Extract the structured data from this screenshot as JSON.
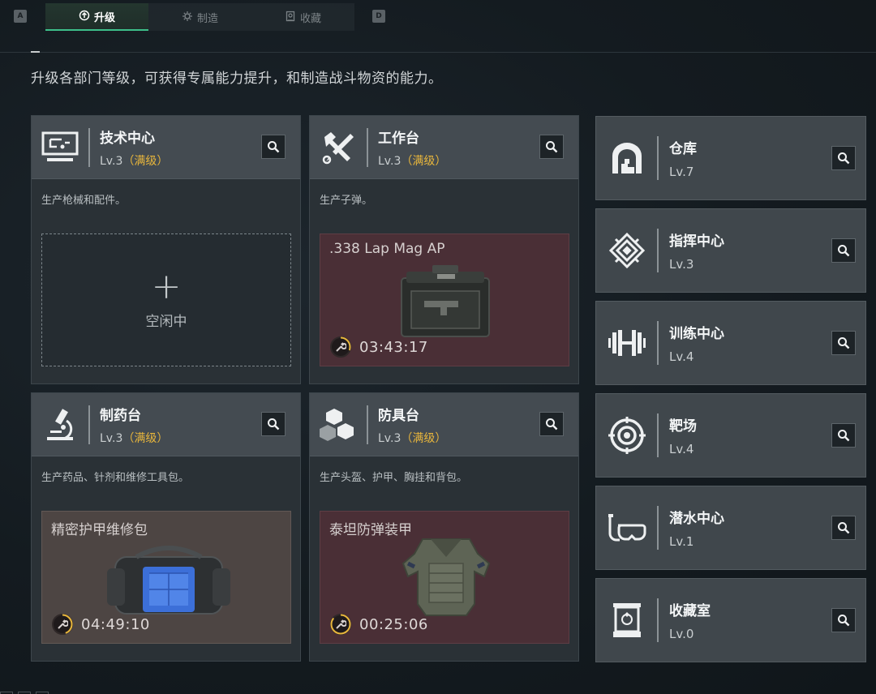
{
  "topbar": {
    "left_key": "A",
    "right_key": "D",
    "tabs": [
      {
        "label": "升级",
        "icon": "upgrade-icon",
        "active": true
      },
      {
        "label": "制造",
        "icon": "craft-icon",
        "active": false
      },
      {
        "label": "收藏",
        "icon": "collection-icon",
        "active": false
      }
    ]
  },
  "description": "升级各部门等级，可获得专属能力提升，和制造战斗物资的能力。",
  "cards": [
    {
      "title": "技术中心",
      "level": "Lv.3",
      "max": "（满级）",
      "desc": "生产枪械和配件。",
      "slot": {
        "state": "idle",
        "label": "空闲中"
      }
    },
    {
      "title": "工作台",
      "level": "Lv.3",
      "max": "（满级）",
      "desc": "生产子弹。",
      "slot": {
        "state": "crafting",
        "item": ".338 Lap Mag AP",
        "time": "03:43:17",
        "progress": 0.3
      }
    },
    {
      "title": "制药台",
      "level": "Lv.3",
      "max": "（满级）",
      "desc": "生产药品、针剂和维修工具包。",
      "slot": {
        "state": "crafting",
        "item": "精密护甲维修包",
        "time": "04:49:10",
        "progress": 0.45
      }
    },
    {
      "title": "防具台",
      "level": "Lv.3",
      "max": "（满级）",
      "desc": "生产头盔、护甲、胸挂和背包。",
      "slot": {
        "state": "crafting",
        "item": "泰坦防弹装甲",
        "time": "00:25:06",
        "progress": 0.85
      }
    }
  ],
  "facilities": [
    {
      "title": "仓库",
      "level": "Lv.7",
      "icon": "warehouse-icon"
    },
    {
      "title": "指挥中心",
      "level": "Lv.3",
      "icon": "command-center-icon"
    },
    {
      "title": "训练中心",
      "level": "Lv.4",
      "icon": "dumbbell-icon"
    },
    {
      "title": "靶场",
      "level": "Lv.4",
      "icon": "target-icon"
    },
    {
      "title": "潜水中心",
      "level": "Lv.1",
      "icon": "diving-mask-icon"
    },
    {
      "title": "收藏室",
      "level": "Lv.0",
      "icon": "trophy-case-icon"
    }
  ],
  "colors": {
    "accent": "#3dbf8a",
    "max_level": "#e8b63c",
    "timer_ring": "#e8b63c"
  }
}
